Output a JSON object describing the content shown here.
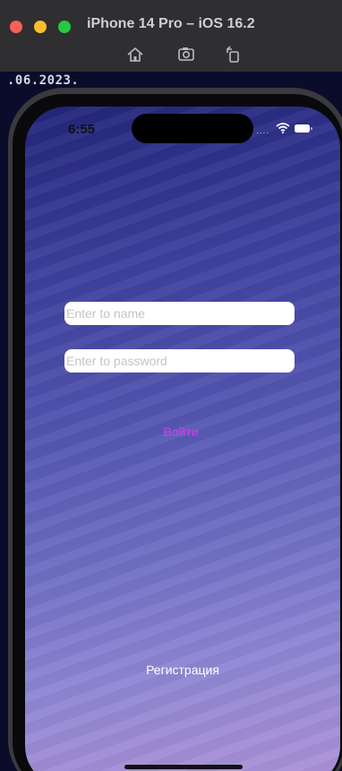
{
  "simulator": {
    "title": "iPhone 14 Pro – iOS 16.2",
    "toolbar_icons": [
      "home-icon",
      "screenshot-icon",
      "rotate-icon"
    ]
  },
  "editor": {
    "visible_text": ".06.2023."
  },
  "status_bar": {
    "time": "6:55",
    "signal": "....",
    "icons": [
      "wifi-icon",
      "battery-icon"
    ]
  },
  "login": {
    "name_placeholder": "Enter to name",
    "name_value": "",
    "password_placeholder": "Enter to password",
    "password_value": "",
    "login_label": "Войти",
    "register_label": "Регистрация"
  },
  "colors": {
    "login_button": "#d63af0",
    "register_button": "#ffffff",
    "traffic_red": "#fe5f57",
    "traffic_yellow": "#febc2e",
    "traffic_green": "#28c840"
  }
}
